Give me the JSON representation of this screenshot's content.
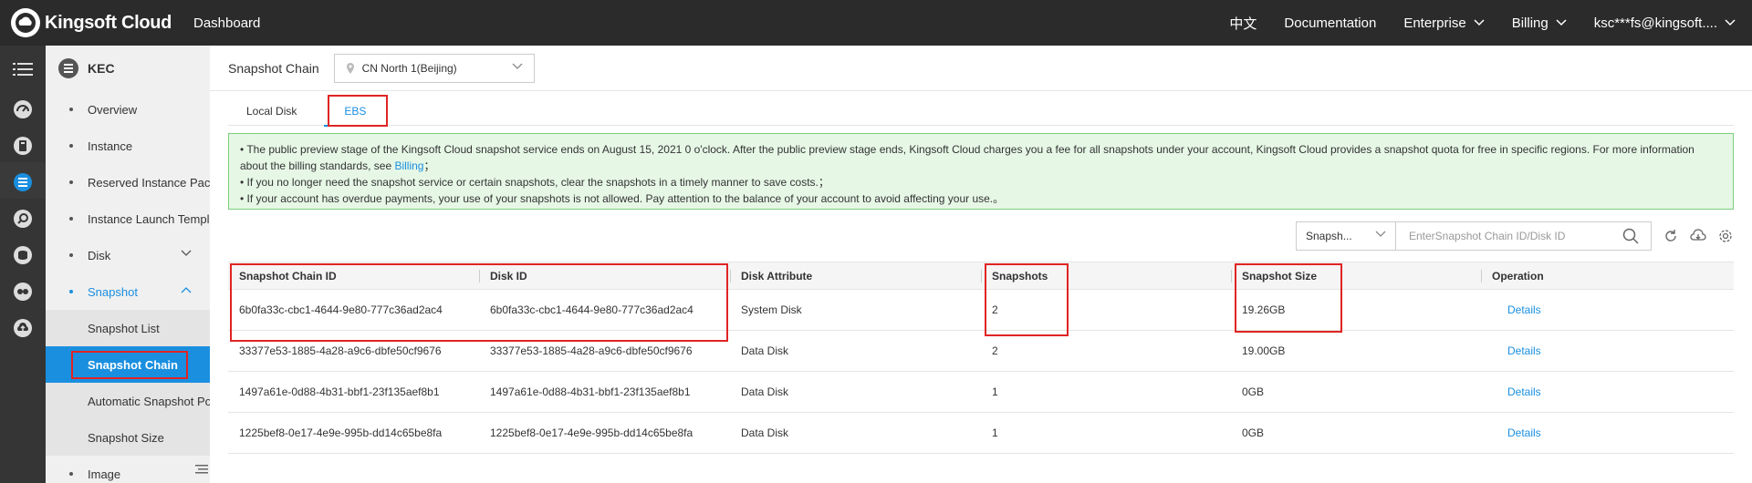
{
  "topbar": {
    "brand": "Kingsoft Cloud",
    "dashboard": "Dashboard",
    "lang": "中文",
    "documentation": "Documentation",
    "enterprise": "Enterprise",
    "billing": "Billing",
    "account": "ksc***fs@kingsoft...."
  },
  "sidebar": {
    "title": "KEC",
    "items": [
      {
        "label": "Overview"
      },
      {
        "label": "Instance"
      },
      {
        "label": "Reserved Instance Packages"
      },
      {
        "label": "Instance Launch Templates"
      },
      {
        "label": "Disk"
      },
      {
        "label": "Snapshot"
      },
      {
        "label": "Image"
      }
    ],
    "snapshot_sub": [
      {
        "label": "Snapshot List"
      },
      {
        "label": "Snapshot Chain"
      },
      {
        "label": "Automatic Snapshot Policy"
      },
      {
        "label": "Snapshot Size"
      }
    ]
  },
  "main": {
    "title": "Snapshot Chain",
    "region": "CN North 1(Beijing)",
    "tabs": [
      {
        "label": "Local Disk"
      },
      {
        "label": "EBS"
      }
    ],
    "notice": {
      "line1": "• The public preview stage of the Kingsoft Cloud snapshot service ends on August 15, 2021 0 o'clock. After the public preview stage ends, Kingsoft Cloud charges you a fee for all snapshots under your account, Kingsoft Cloud provides a snapshot quota for free in specific regions. For more information",
      "line2_prefix": "about the billing standards, see ",
      "billing_link": "Billing",
      "line2_suffix": "；",
      "line3": "• If you no longer need the snapshot service or certain snapshots, clear the snapshots in a timely manner to save costs.；",
      "line4": "• If your account has overdue payments, your use of your snapshots is not allowed. Pay attention to the balance of your account to avoid affecting your use.。"
    },
    "filter_value": "Snapsh...",
    "search_placeholder": "EnterSnapshot Chain ID/Disk ID"
  },
  "table": {
    "headers": [
      "Snapshot Chain ID",
      "Disk ID",
      "Disk Attribute",
      "Snapshots",
      "Snapshot Size",
      "Operation"
    ],
    "rows": [
      {
        "chain": "6b0fa33c-cbc1-4644-9e80-777c36ad2ac4",
        "disk": "6b0fa33c-cbc1-4644-9e80-777c36ad2ac4",
        "attr": "System Disk",
        "count": "2",
        "size": "19.26GB",
        "op": "Details"
      },
      {
        "chain": "33377e53-1885-4a28-a9c6-dbfe50cf9676",
        "disk": "33377e53-1885-4a28-a9c6-dbfe50cf9676",
        "attr": "Data Disk",
        "count": "2",
        "size": "19.00GB",
        "op": "Details"
      },
      {
        "chain": "1497a61e-0d88-4b31-bbf1-23f135aef8b1",
        "disk": "1497a61e-0d88-4b31-bbf1-23f135aef8b1",
        "attr": "Data Disk",
        "count": "1",
        "size": "0GB",
        "op": "Details"
      },
      {
        "chain": "1225bef8-0e17-4e9e-995b-dd14c65be8fa",
        "disk": "1225bef8-0e17-4e9e-995b-dd14c65be8fa",
        "attr": "Data Disk",
        "count": "1",
        "size": "0GB",
        "op": "Details"
      }
    ]
  },
  "colors": {
    "accent": "#1a8fe0",
    "topbar": "#2b2b2b",
    "highlight": "#e02424",
    "notice_bg": "#e6f7e6"
  }
}
